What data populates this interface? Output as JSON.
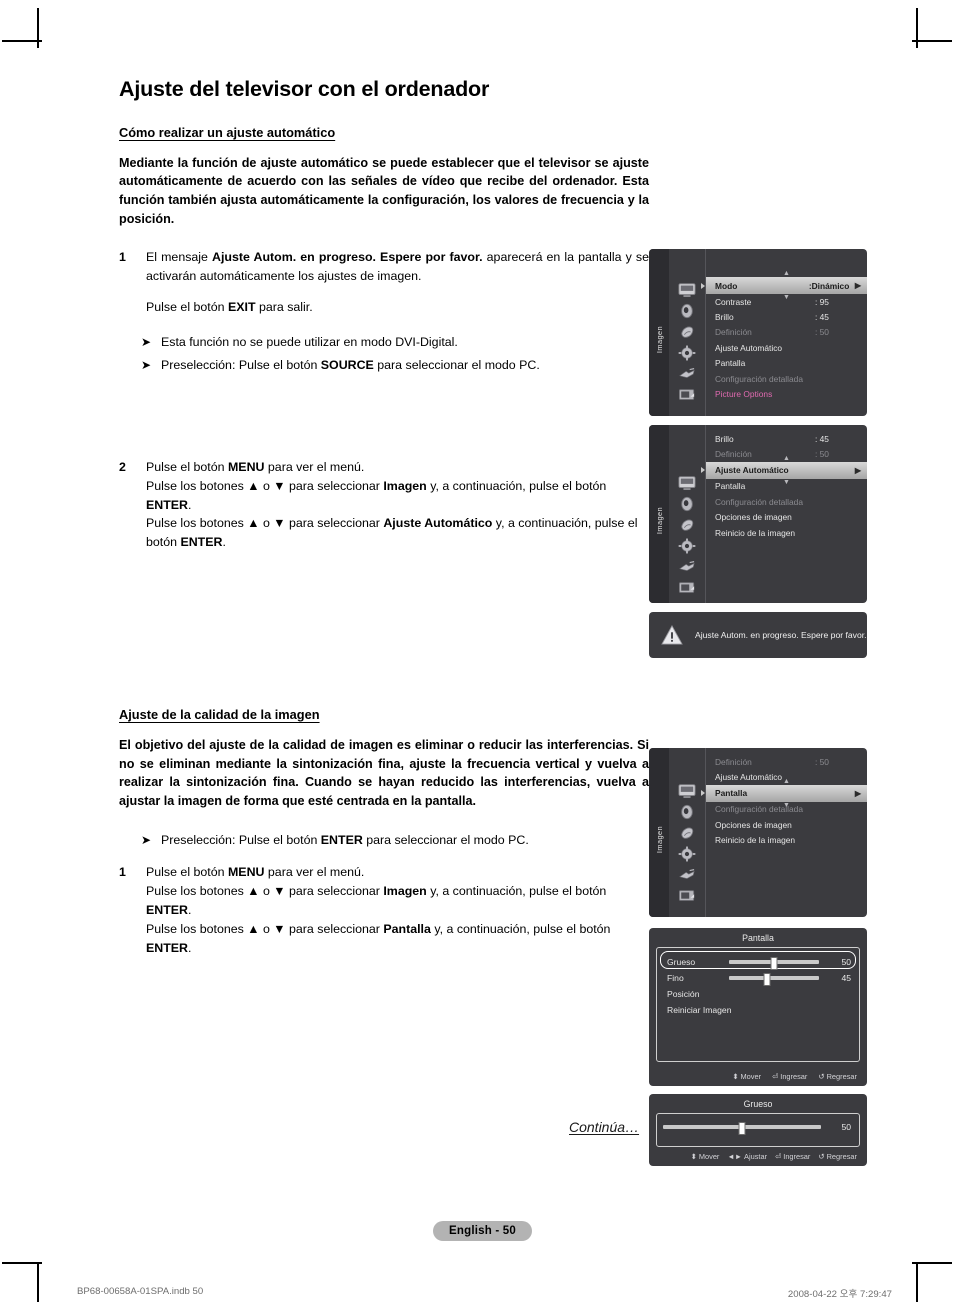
{
  "document": {
    "title": "Ajuste del televisor con el ordenador",
    "section1_heading": "Cómo realizar un ajuste automático",
    "section1_lead": "Mediante la función de ajuste automático se puede establecer que el televisor se ajuste automáticamente de acuerdo con las señales de vídeo que recibe del ordenador. Esta función también ajusta automáticamente la configuración, los valores de frecuencia y la posición.",
    "step1": {
      "number": "1",
      "line1_a": "El mensaje ",
      "line1_b": "Ajuste Autom. en progreso. Espere por favor.",
      "line1_c": " aparecerá en la pantalla y se activarán automáticamente los ajustes de imagen.",
      "line2_a": "Pulse el botón ",
      "line2_b": "EXIT",
      "line2_c": " para salir."
    },
    "bullets1": [
      {
        "text_a": "Esta función no se puede utilizar en modo DVI-Digital.",
        "bold": "",
        "text_b": ""
      },
      {
        "text_a": "Preselección: Pulse el botón ",
        "bold": "SOURCE",
        "text_b": " para seleccionar el modo PC."
      }
    ],
    "step2": {
      "number": "2",
      "l1_a": "Pulse el botón ",
      "l1_b": "MENU",
      "l1_c": " para ver el menú.",
      "l2_a": "Pulse los botones ▲ o ▼ para seleccionar ",
      "l2_b": "Imagen",
      "l2_c": " y, a continuación, pulse el botón ",
      "l2_d": "ENTER",
      "l2_e": ".",
      "l3_a": "Pulse los botones ▲ o ▼ para seleccionar ",
      "l3_b": "Ajuste Automático",
      "l3_c": " y, a continuación, pulse el botón ",
      "l3_d": "ENTER",
      "l3_e": "."
    },
    "section2_heading": "Ajuste de la calidad de la imagen",
    "section2_lead": "El objetivo del ajuste de la calidad de imagen es eliminar o reducir las interferencias. Si no se eliminan mediante la sintonización fina, ajuste la frecuencia vertical y vuelva a realizar la sintonización fina. Cuando se hayan reducido las interferencias, vuelva a ajustar la imagen de forma que esté centrada en la pantalla.",
    "bullets2": [
      {
        "text_a": "Preselección: Pulse el botón ",
        "bold": "ENTER",
        "text_b": " para seleccionar el modo PC."
      }
    ],
    "step3": {
      "number": "1",
      "l1_a": "Pulse el botón ",
      "l1_b": "MENU",
      "l1_c": " para ver el menú.",
      "l2_a": "Pulse los botones ▲ o ▼ para seleccionar ",
      "l2_b": "Imagen",
      "l2_c": " y, a continuación, pulse el botón ",
      "l2_d": "ENTER",
      "l2_e": ".",
      "l3_a": "Pulse los botones ▲ o ▼ para seleccionar ",
      "l3_b": "Pantalla",
      "l3_c": " y, a continuación, pulse el botón ",
      "l3_d": "ENTER",
      "l3_e": "."
    },
    "continued": "Continúa…",
    "page_badge": "English - 50",
    "footer_left": "BP68-00658A-01SPA.indb   50",
    "footer_right": "2008-04-22   오후 7:29:47"
  },
  "osd": {
    "rail_label": "Imagen",
    "icons": [
      "picture-icon",
      "sound-icon",
      "channel-icon",
      "setup-icon",
      "input-icon",
      "support-icon"
    ],
    "menu1": {
      "rows": [
        {
          "label": "Modo",
          "value": ":Dinámico",
          "state": "selected",
          "arrow": "▶"
        },
        {
          "label": "Contraste",
          "value": ": 95",
          "state": "normal"
        },
        {
          "label": "Brillo",
          "value": ": 45",
          "state": "normal"
        },
        {
          "label": "Definición",
          "value": ": 50",
          "state": "dim"
        },
        {
          "label": "Ajuste Automático",
          "value": "",
          "state": "normal"
        },
        {
          "label": "Pantalla",
          "value": "",
          "state": "normal"
        },
        {
          "label": "Configuración detallada",
          "value": "",
          "state": "dim"
        },
        {
          "label": "Picture Options",
          "value": "",
          "state": "pink"
        }
      ]
    },
    "menu2": {
      "rows": [
        {
          "label": "Brillo",
          "value": ": 45",
          "state": "normal"
        },
        {
          "label": "Definición",
          "value": ": 50",
          "state": "dim"
        },
        {
          "label": "Ajuste Automático",
          "value": "",
          "state": "selected",
          "arrow": "▶"
        },
        {
          "label": "Pantalla",
          "value": "",
          "state": "normal"
        },
        {
          "label": "Configuración detallada",
          "value": "",
          "state": "dim"
        },
        {
          "label": "Opciones de imagen",
          "value": "",
          "state": "normal"
        },
        {
          "label": "Reinicio de la imagen",
          "value": "",
          "state": "normal"
        }
      ]
    },
    "toast": {
      "icon": "warning-icon",
      "message": "Ajuste Autom. en progreso. Espere por favor."
    },
    "menu3": {
      "rows": [
        {
          "label": "Definición",
          "value": ": 50",
          "state": "dim"
        },
        {
          "label": "Ajuste Automático",
          "value": "",
          "state": "normal"
        },
        {
          "label": "Pantalla",
          "value": "",
          "state": "selected",
          "arrow": "▶"
        },
        {
          "label": "Configuración detallada",
          "value": "",
          "state": "dim"
        },
        {
          "label": "Opciones de imagen",
          "value": "",
          "state": "normal"
        },
        {
          "label": "Reinicio de la imagen",
          "value": "",
          "state": "normal"
        }
      ]
    },
    "dialog_pantalla": {
      "title": "Pantalla",
      "sliders": [
        {
          "label": "Grueso",
          "value": "50",
          "percent": 50,
          "selected": true
        },
        {
          "label": "Fino",
          "value": "45",
          "percent": 42,
          "selected": false
        }
      ],
      "items": [
        "Posición",
        "Reiniciar Imagen"
      ],
      "footer": [
        {
          "glyph": "⬍",
          "text": "Mover"
        },
        {
          "glyph": "⏎",
          "text": "Ingresar"
        },
        {
          "glyph": "↺",
          "text": "Regresar"
        }
      ]
    },
    "dialog_grueso": {
      "title": "Grueso",
      "slider": {
        "value": "50",
        "percent": 50
      },
      "footer": [
        {
          "glyph": "⬍",
          "text": "Mover"
        },
        {
          "glyph": "◄►",
          "text": "Ajustar"
        },
        {
          "glyph": "⏎",
          "text": "Ingresar"
        },
        {
          "glyph": "↺",
          "text": "Regresar"
        }
      ]
    }
  },
  "colors": {
    "osd_bg": "#3b3b3f",
    "osd_rail": "#2c2c30",
    "highlight": "#c6c6c6",
    "pink_item": "#e06ab0",
    "dim_text": "#8b8b90",
    "badge_bg": "#b3b3b3"
  }
}
